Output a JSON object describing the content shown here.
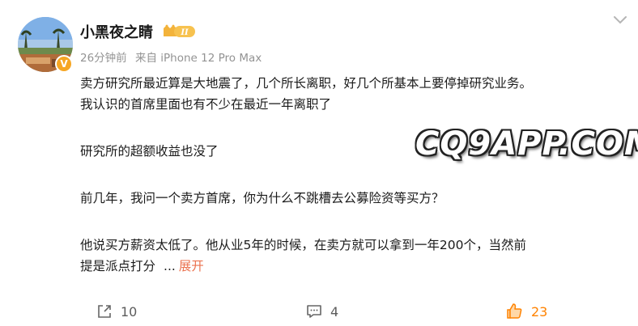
{
  "user": {
    "name": "小黑夜之睛",
    "level_badge": "II",
    "verified_badge": "V"
  },
  "meta": {
    "time": "26分钟前",
    "source": "来自 iPhone 12 Pro Max"
  },
  "post": {
    "paragraphs": [
      "卖方研究所最近算是大地震了，几个所长离职，好几个所基本上要停掉研究业务。",
      "我认识的首席里面也有不少在最近一年离职了",
      "研究所的超额收益也没了",
      "前几年，我问一个卖方首席，你为什么不跳槽去公募险资等买方？",
      "他说买方薪资太低了。他从业5年的时候，在卖方就可以拿到一年200个，当然前",
      "提是派点打分"
    ],
    "ellipsis": "...",
    "expand_label": "展开"
  },
  "watermark": "CQ9APP.COM",
  "actions": {
    "repost_count": "10",
    "comment_count": "4",
    "like_count": "23"
  },
  "icons": {
    "more": "chevron-down-icon",
    "repost": "repost-icon",
    "comment": "comment-icon",
    "like": "thumbs-up-icon"
  },
  "colors": {
    "accent": "#eb7350",
    "like": "#ff8200",
    "meta": "#939393"
  }
}
